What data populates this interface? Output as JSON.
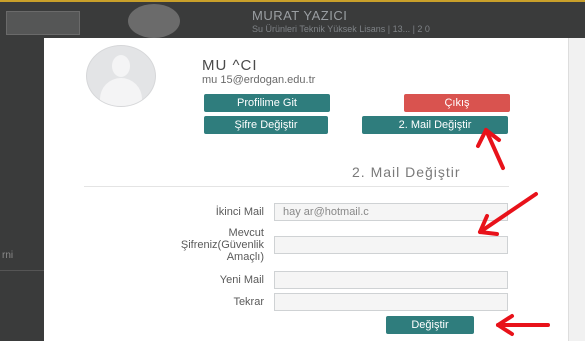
{
  "header": {
    "name": "MURAT YAZICI",
    "subtitle": "Su Ürünleri Teknik Yüksek Lisans | 13...  | 2 0"
  },
  "left_strip": {
    "text": "rni"
  },
  "profile": {
    "name_visible": "MU          ^CI",
    "email_visible": "mu                15@erdogan.edu.tr"
  },
  "buttons": {
    "profile": "Profilime Git",
    "logout": "Çıkış",
    "change_password": "Şifre Değiştir",
    "change_mail": "2. Mail Değiştir",
    "submit": "Değiştir"
  },
  "form": {
    "title": "2. Mail Değiştir",
    "labels": {
      "second_mail": "İkinci Mail",
      "current_password_line1": "Mevcut",
      "current_password_line2": "Şifreniz(Güvenlik",
      "current_password_line3": "Amaçlı)",
      "new_mail": "Yeni Mail",
      "repeat": "Tekrar"
    },
    "values": {
      "second_mail": "hay                   ar@hotmail.c"
    }
  },
  "colors": {
    "teal": "#2f7d7d",
    "red": "#d9534f",
    "arrow": "#e8121a",
    "header_bg": "#3a3b3b"
  }
}
